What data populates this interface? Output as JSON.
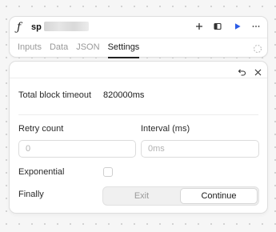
{
  "header": {
    "fn_glyph": "ƒ",
    "block_name": "sp",
    "icons": [
      "plus-icon",
      "panel-icon",
      "play-icon",
      "more-icon"
    ],
    "accent": "#2b5be6"
  },
  "tabs": [
    {
      "label": "Inputs",
      "active": false
    },
    {
      "label": "Data",
      "active": false
    },
    {
      "label": "JSON",
      "active": false
    },
    {
      "label": "Settings",
      "active": true
    }
  ],
  "settings": {
    "timeout_label": "Total block timeout",
    "timeout_value": "820000ms",
    "retry_label": "Retry count",
    "retry_placeholder": "0",
    "interval_label": "Interval (ms)",
    "interval_placeholder": "0ms",
    "exponential_label": "Exponential",
    "exponential_checked": false,
    "finally_label": "Finally",
    "finally_options": [
      "Exit",
      "Continue"
    ],
    "finally_selected": "Continue"
  }
}
